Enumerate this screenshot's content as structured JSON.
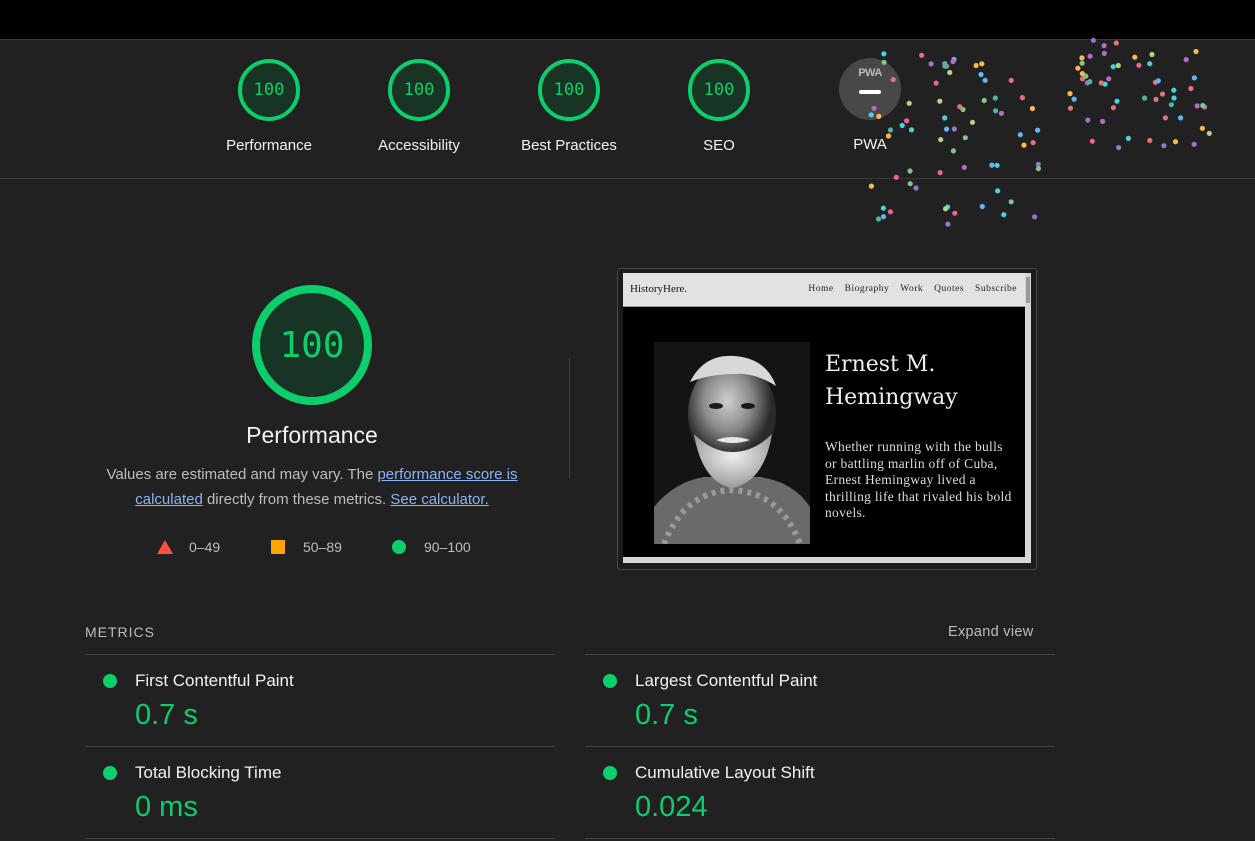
{
  "scores": [
    {
      "label": "Performance",
      "score": "100"
    },
    {
      "label": "Accessibility",
      "score": "100"
    },
    {
      "label": "Best Practices",
      "score": "100"
    },
    {
      "label": "SEO",
      "score": "100"
    }
  ],
  "pwa": {
    "badge": "PWA",
    "label": "PWA"
  },
  "performance": {
    "score": "100",
    "title": "Performance",
    "desc_pre": "Values are estimated and may vary. The ",
    "desc_link1": "performance score is calculated",
    "desc_mid": " directly from these metrics. ",
    "desc_link2": "See calculator."
  },
  "legend": {
    "fail": "0–49",
    "average": "50–89",
    "pass": "90–100"
  },
  "screenshot": {
    "logo": "HistoryHere.",
    "nav": [
      "Home",
      "Biography",
      "Work",
      "Quotes",
      "Subscribe"
    ],
    "title": "Ernest M. Hemingway",
    "text": "Whether running with the bulls or battling marlin off of Cuba, Ernest Hemingway lived a thrilling life that rivaled his bold novels."
  },
  "metrics": {
    "header": "METRICS",
    "expand": "Expand view",
    "items": [
      {
        "title": "First Contentful Paint",
        "value": "0.7 s"
      },
      {
        "title": "Largest Contentful Paint",
        "value": "0.7 s"
      },
      {
        "title": "Total Blocking Time",
        "value": "0 ms"
      },
      {
        "title": "Cumulative Layout Shift",
        "value": "0.024"
      }
    ]
  },
  "colors": {
    "pass": "#0cce6b",
    "average": "#ffa400",
    "fail": "#ff4e42",
    "link": "#8ab4f8",
    "background": "#212121"
  }
}
